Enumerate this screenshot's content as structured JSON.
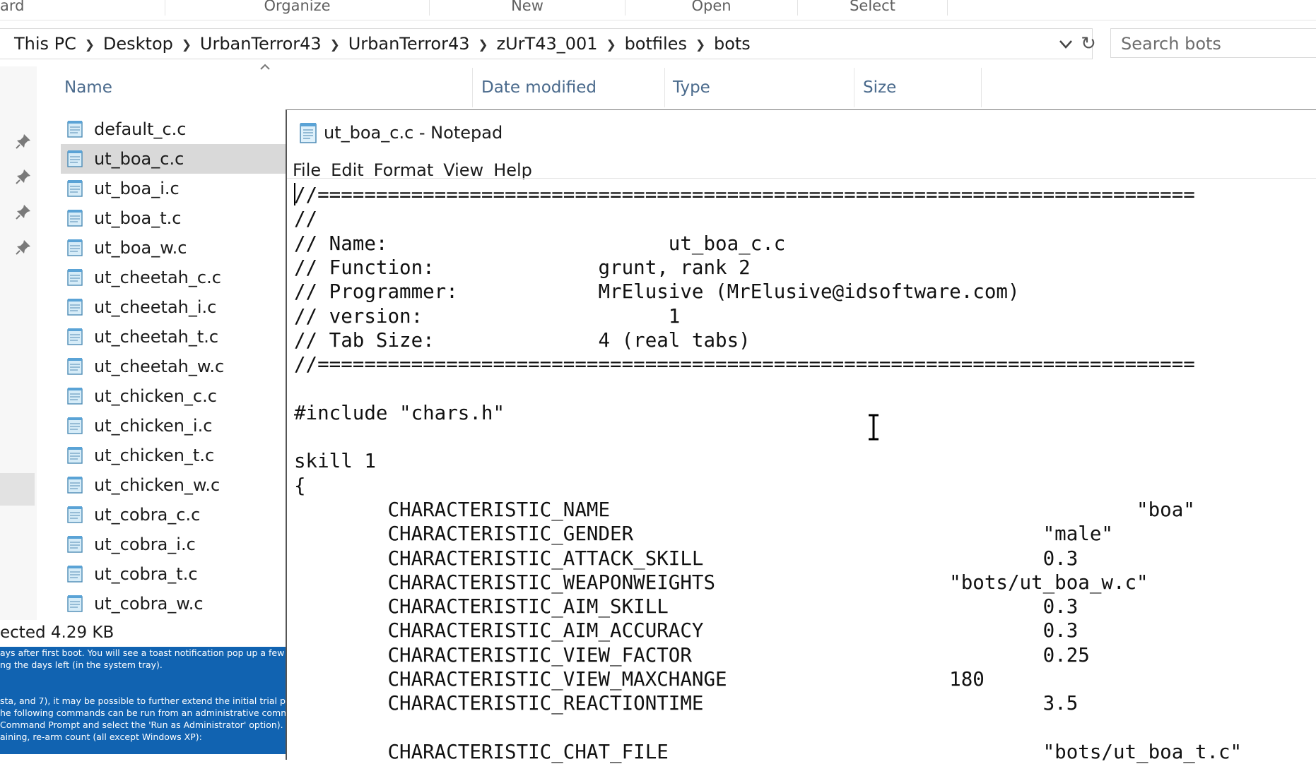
{
  "ribbon": {
    "groups": [
      "ard",
      "Organize",
      "New",
      "Open",
      "Select"
    ]
  },
  "address": {
    "breadcrumbs": [
      "This PC",
      "Desktop",
      "UrbanTerror43",
      "UrbanTerror43",
      "zUrT43_001",
      "botfiles",
      "bots"
    ],
    "search_placeholder": "Search bots"
  },
  "columns": {
    "name": "Name",
    "date": "Date modified",
    "type": "Type",
    "size": "Size"
  },
  "files": [
    "default_c.c",
    "ut_boa_c.c",
    "ut_boa_i.c",
    "ut_boa_t.c",
    "ut_boa_w.c",
    "ut_cheetah_c.c",
    "ut_cheetah_i.c",
    "ut_cheetah_t.c",
    "ut_cheetah_w.c",
    "ut_chicken_c.c",
    "ut_chicken_i.c",
    "ut_chicken_t.c",
    "ut_chicken_w.c",
    "ut_cobra_c.c",
    "ut_cobra_i.c",
    "ut_cobra_t.c",
    "ut_cobra_w.c"
  ],
  "selected_file": "ut_boa_c.c",
  "status": {
    "text": "ected  4.29 KB"
  },
  "background_doc": {
    "lines": [
      "ays after first boot. You will see a toast notification pop up a few",
      "ng the days left (in the system tray).",
      "",
      "",
      "sta, and 7), it may be possible to further extend the initial trial period",
      "he following commands can be run from an administrative command",
      " Command Prompt and select the 'Run as Administrator' option).",
      "aining, re-arm count (all except Windows XP):"
    ]
  },
  "notepad": {
    "title": "ut_boa_c.c - Notepad",
    "menu": [
      "File",
      "Edit",
      "Format",
      "View",
      "Help"
    ],
    "lines": [
      "//===========================================================================",
      "//",
      "// Name:                        ut_boa_c.c",
      "// Function:              grunt, rank 2",
      "// Programmer:            MrElusive (MrElusive@idsoftware.com)",
      "// version:                     1",
      "// Tab Size:              4 (real tabs)",
      "//===========================================================================",
      "",
      "#include \"chars.h\"",
      "",
      "skill 1",
      "{",
      "        CHARACTERISTIC_NAME                                             \"boa\"",
      "        CHARACTERISTIC_GENDER                                   \"male\"",
      "        CHARACTERISTIC_ATTACK_SKILL                             0.3",
      "        CHARACTERISTIC_WEAPONWEIGHTS                    \"bots/ut_boa_w.c\"",
      "        CHARACTERISTIC_AIM_SKILL                                0.3",
      "        CHARACTERISTIC_AIM_ACCURACY                             0.3",
      "        CHARACTERISTIC_VIEW_FACTOR                              0.25",
      "        CHARACTERISTIC_VIEW_MAXCHANGE                   180",
      "        CHARACTERISTIC_REACTIONTIME                             3.5",
      "",
      "        CHARACTERISTIC_CHAT_FILE                                \"bots/ut_boa_t.c\""
    ]
  },
  "colors": {
    "selection": "#d9d9d9",
    "header_text": "#4a6a8c",
    "doc_blue": "#1163b1"
  },
  "icons": [
    "chevron-right-icon",
    "chevron-down-icon",
    "refresh-icon",
    "pin-icon",
    "notepad-file-icon",
    "text-cursor-icon",
    "sort-up-icon"
  ]
}
